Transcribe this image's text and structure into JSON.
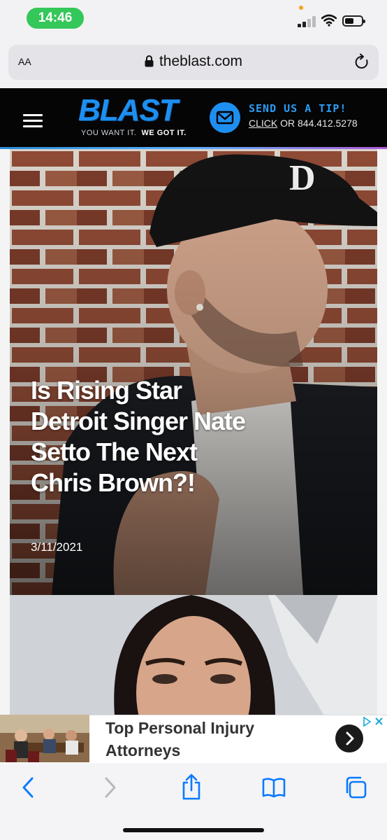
{
  "status_bar": {
    "time": "14:46"
  },
  "browser": {
    "aa_label": "AA",
    "url": "theblast.com"
  },
  "site_header": {
    "logo_text": "BLAST",
    "tagline_part1": "YOU WANT IT.",
    "tagline_part2": "WE GOT IT.",
    "tip_title": "SEND US A TIP!",
    "tip_click": "CLICK",
    "tip_rest": "OR 844.412.5278"
  },
  "articles": [
    {
      "headline": "Is Rising Star Detroit Singer Nate Setto The Next Chris Brown?!",
      "date": "3/11/2021"
    }
  ],
  "ad": {
    "text": "Top Personal Injury Attorneys"
  },
  "colors": {
    "brand_blue": "#1e8ff0",
    "status_green": "#34c759",
    "ios_blue": "#0a7aff"
  }
}
